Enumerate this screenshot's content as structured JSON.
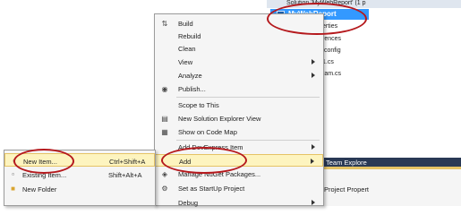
{
  "solution_explorer": {
    "root_label": "Solution 'MyWebReport' (1 p",
    "project_label": "MyWebReport",
    "items": [
      "erties",
      "rences",
      ".config",
      "1.cs",
      "ram.cs"
    ]
  },
  "context_menu": {
    "items": [
      {
        "label": "Build",
        "icon": "build-icon"
      },
      {
        "label": "Rebuild"
      },
      {
        "label": "Clean"
      },
      {
        "label": "View",
        "submenu": true
      },
      {
        "label": "Analyze",
        "submenu": true
      },
      {
        "label": "Publish...",
        "icon": "publish-icon"
      },
      {
        "label": "Scope to This"
      },
      {
        "label": "New Solution Explorer View",
        "icon": "solution-explorer-icon"
      },
      {
        "label": "Show on Code Map",
        "icon": "code-map-icon"
      },
      {
        "label": "Add DevExpress Item",
        "submenu": true
      },
      {
        "label": "Add",
        "submenu": true,
        "highlighted": true
      },
      {
        "label": "Manage NuGet Packages...",
        "icon": "nuget-icon"
      },
      {
        "label": "Set as StartUp Project",
        "icon": "gear-icon"
      },
      {
        "label": "Debug",
        "submenu": true
      }
    ]
  },
  "add_submenu": {
    "items": [
      {
        "label": "New Item...",
        "shortcut": "Ctrl+Shift+A",
        "highlighted": true
      },
      {
        "label": "Existing Item...",
        "shortcut": "Shift+Alt+A"
      },
      {
        "label": "New Folder",
        "shortcut": ""
      }
    ]
  },
  "tabs": {
    "team_explorer": "Team Explore",
    "properties": "Project Propert"
  },
  "colors": {
    "selection": "#3399ff",
    "highlight": "#fdf4bf",
    "annotation": "#b5191d",
    "tab_bar": "#293955"
  }
}
